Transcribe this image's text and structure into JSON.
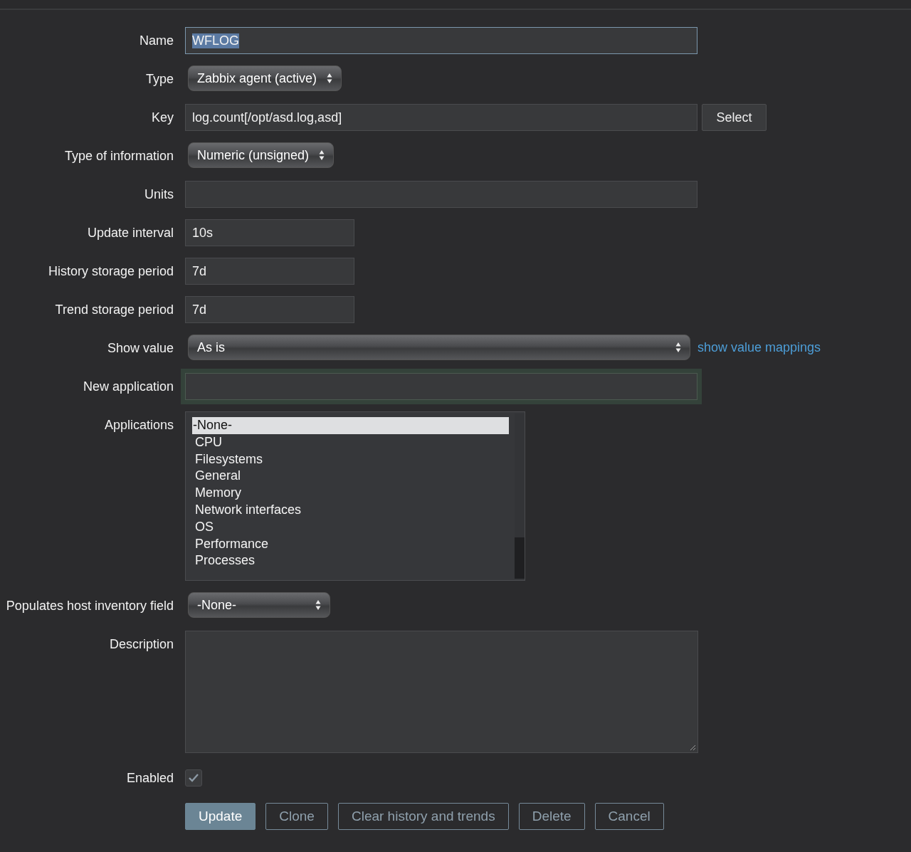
{
  "form": {
    "rows": [
      {
        "label": "Name",
        "kind": "text",
        "value": "WFLOG",
        "text_selected": true
      },
      {
        "label": "Type",
        "kind": "select",
        "value": "Zabbix agent (active)"
      },
      {
        "label": "Key",
        "kind": "text",
        "value": "log.count[/opt/asd.log,asd]",
        "button": "Select"
      },
      {
        "label": "Type of information",
        "kind": "select",
        "value": "Numeric (unsigned)"
      },
      {
        "label": "Units",
        "kind": "text",
        "value": ""
      },
      {
        "label": "Update interval",
        "kind": "short-text",
        "value": "10s"
      },
      {
        "label": "History storage period",
        "kind": "short-text",
        "value": "7d"
      },
      {
        "label": "Trend storage period",
        "kind": "short-text",
        "value": "7d"
      },
      {
        "label": "Show value",
        "kind": "wide-select",
        "value": "As is",
        "link": "show value mappings"
      },
      {
        "label": "New application",
        "kind": "text",
        "value": "",
        "focused": true
      },
      {
        "label": "Applications",
        "kind": "listbox",
        "options": [
          {
            "label": "-None-",
            "selected": true
          },
          {
            "label": "CPU",
            "selected": false
          },
          {
            "label": "Filesystems",
            "selected": false
          },
          {
            "label": "General",
            "selected": false
          },
          {
            "label": "Memory",
            "selected": false
          },
          {
            "label": "Network interfaces",
            "selected": false
          },
          {
            "label": "OS",
            "selected": false
          },
          {
            "label": "Performance",
            "selected": false
          },
          {
            "label": "Processes",
            "selected": false
          }
        ]
      },
      {
        "label": "Populates host inventory field",
        "kind": "select",
        "value": "-None-"
      },
      {
        "label": "Description",
        "kind": "textarea",
        "value": ""
      },
      {
        "label": "Enabled",
        "kind": "checkbox",
        "checked": true
      }
    ],
    "buttons": [
      {
        "label": "Update",
        "kind": "primary"
      },
      {
        "label": "Clone",
        "kind": "secondary"
      },
      {
        "label": "Clear history and trends",
        "kind": "secondary"
      },
      {
        "label": "Delete",
        "kind": "secondary"
      },
      {
        "label": "Cancel",
        "kind": "secondary"
      }
    ]
  }
}
